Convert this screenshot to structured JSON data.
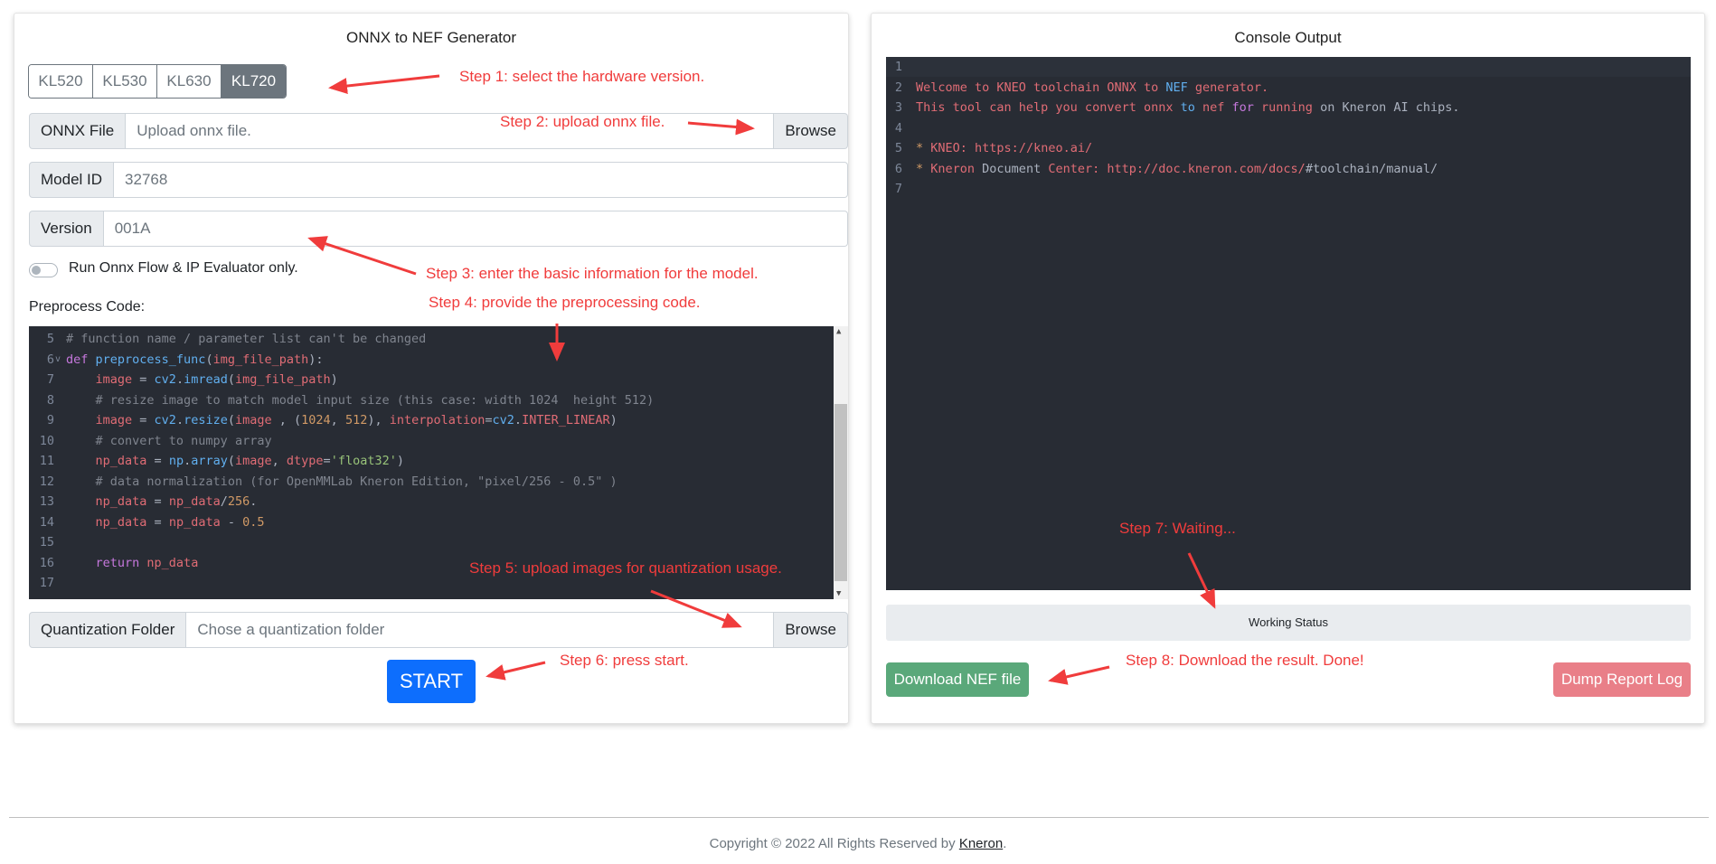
{
  "left_panel": {
    "title": "ONNX to NEF Generator",
    "hardware_options": [
      "KL520",
      "KL530",
      "KL630",
      "KL720"
    ],
    "hardware_selected": "KL720",
    "onnx_label": "ONNX File",
    "onnx_placeholder": "Upload onnx file.",
    "browse_label": "Browse",
    "model_id_label": "Model ID",
    "model_id_placeholder": "32768",
    "version_label": "Version",
    "version_placeholder": "001A",
    "toggle_label": "Run Onnx Flow & IP Evaluator only.",
    "toggle_on": false,
    "preprocess_label": "Preprocess Code:",
    "quant_label": "Quantization Folder",
    "quant_placeholder": "Chose a quantization folder",
    "quant_browse_label": "Browse",
    "start_label": "START"
  },
  "code_lines": [
    {
      "n": "5",
      "fold": "",
      "tokens": [
        [
          "c-cm",
          "# function name / parameter list can't be changed"
        ]
      ]
    },
    {
      "n": "6",
      "fold": "v",
      "tokens": [
        [
          "c-kw",
          "def "
        ],
        [
          "c-fn",
          "preprocess_func"
        ],
        [
          "c-pl",
          "("
        ],
        [
          "c-var",
          "img_file_path"
        ],
        [
          "c-pl",
          "):"
        ]
      ]
    },
    {
      "n": "7",
      "fold": "",
      "tokens": [
        [
          "c-pl",
          "    "
        ],
        [
          "c-var",
          "image"
        ],
        [
          "c-pl",
          " = "
        ],
        [
          "c-fn",
          "cv2"
        ],
        [
          "c-pl",
          "."
        ],
        [
          "c-fn",
          "imread"
        ],
        [
          "c-pl",
          "("
        ],
        [
          "c-var",
          "img_file_path"
        ],
        [
          "c-pl",
          ")"
        ]
      ]
    },
    {
      "n": "8",
      "fold": "",
      "tokens": [
        [
          "c-pl",
          "    "
        ],
        [
          "c-cm",
          "# resize image to match model input size (this case: width 1024  height 512)"
        ]
      ]
    },
    {
      "n": "9",
      "fold": "",
      "tokens": [
        [
          "c-pl",
          "    "
        ],
        [
          "c-var",
          "image"
        ],
        [
          "c-pl",
          " = "
        ],
        [
          "c-fn",
          "cv2"
        ],
        [
          "c-pl",
          "."
        ],
        [
          "c-fn",
          "resize"
        ],
        [
          "c-pl",
          "("
        ],
        [
          "c-var",
          "image"
        ],
        [
          "c-pl",
          " , ("
        ],
        [
          "c-num",
          "1024"
        ],
        [
          "c-pl",
          ", "
        ],
        [
          "c-num",
          "512"
        ],
        [
          "c-pl",
          "), "
        ],
        [
          "c-var",
          "interpolation"
        ],
        [
          "c-pl",
          "="
        ],
        [
          "c-fn",
          "cv2"
        ],
        [
          "c-pl",
          "."
        ],
        [
          "c-var",
          "INTER_LINEAR"
        ],
        [
          "c-pl",
          ")"
        ]
      ]
    },
    {
      "n": "10",
      "fold": "",
      "tokens": [
        [
          "c-pl",
          "    "
        ],
        [
          "c-cm",
          "# convert to numpy array"
        ]
      ]
    },
    {
      "n": "11",
      "fold": "",
      "tokens": [
        [
          "c-pl",
          "    "
        ],
        [
          "c-var",
          "np_data"
        ],
        [
          "c-pl",
          " = "
        ],
        [
          "c-fn",
          "np"
        ],
        [
          "c-pl",
          "."
        ],
        [
          "c-fn",
          "array"
        ],
        [
          "c-pl",
          "("
        ],
        [
          "c-var",
          "image"
        ],
        [
          "c-pl",
          ", "
        ],
        [
          "c-var",
          "dtype"
        ],
        [
          "c-pl",
          "="
        ],
        [
          "c-str",
          "'float32'"
        ],
        [
          "c-pl",
          ")"
        ]
      ]
    },
    {
      "n": "12",
      "fold": "",
      "tokens": [
        [
          "c-pl",
          "    "
        ],
        [
          "c-cm",
          "# data normalization (for OpenMMLab Kneron Edition, \"pixel/256 - 0.5\" )"
        ]
      ]
    },
    {
      "n": "13",
      "fold": "",
      "tokens": [
        [
          "c-pl",
          "    "
        ],
        [
          "c-var",
          "np_data"
        ],
        [
          "c-pl",
          " = "
        ],
        [
          "c-var",
          "np_data"
        ],
        [
          "c-pl",
          "/"
        ],
        [
          "c-num",
          "256"
        ],
        [
          "c-pl",
          "."
        ]
      ]
    },
    {
      "n": "14",
      "fold": "",
      "tokens": [
        [
          "c-pl",
          "    "
        ],
        [
          "c-var",
          "np_data"
        ],
        [
          "c-pl",
          " = "
        ],
        [
          "c-var",
          "np_data"
        ],
        [
          "c-pl",
          " - "
        ],
        [
          "c-num",
          "0.5"
        ]
      ]
    },
    {
      "n": "15",
      "fold": "",
      "tokens": []
    },
    {
      "n": "16",
      "fold": "",
      "tokens": [
        [
          "c-pl",
          "    "
        ],
        [
          "c-kw",
          "return "
        ],
        [
          "c-var",
          "np_data"
        ]
      ]
    },
    {
      "n": "17",
      "fold": "",
      "tokens": []
    }
  ],
  "right_panel": {
    "title": "Console Output",
    "status_label": "Working Status",
    "download_label": "Download NEF file",
    "dump_label": "Dump Report Log"
  },
  "console_lines": [
    {
      "n": "1",
      "tokens": []
    },
    {
      "n": "2",
      "tokens": [
        [
          "c-var",
          "Welcome to KNEO toolchain ONNX to "
        ],
        [
          "c-fn",
          "NEF"
        ],
        [
          "c-var",
          " generator."
        ]
      ]
    },
    {
      "n": "3",
      "tokens": [
        [
          "c-var",
          "This tool can help you convert onnx "
        ],
        [
          "c-fn",
          "to"
        ],
        [
          "c-var",
          " nef "
        ],
        [
          "c-kw",
          "for"
        ],
        [
          "c-var",
          " running "
        ],
        [
          "c-pl",
          "on Kneron AI chips."
        ]
      ]
    },
    {
      "n": "4",
      "tokens": []
    },
    {
      "n": "5",
      "tokens": [
        [
          "c-num",
          "* "
        ],
        [
          "c-var",
          "KNEO: "
        ],
        [
          "c-var",
          "https://kneo.ai/"
        ]
      ]
    },
    {
      "n": "6",
      "tokens": [
        [
          "c-num",
          "* "
        ],
        [
          "c-var",
          "Kneron "
        ],
        [
          "c-pl",
          "Document "
        ],
        [
          "c-var",
          "Center: "
        ],
        [
          "c-var",
          "http://doc.kneron.com/docs/"
        ],
        [
          "c-pl",
          "#toolchain/manual/"
        ]
      ]
    },
    {
      "n": "7",
      "tokens": []
    }
  ],
  "annotations": {
    "step1": "Step 1: select the hardware version.",
    "step2": "Step 2: upload onnx file.",
    "step3": "Step 3: enter the basic information for the model.",
    "step4": "Step 4: provide the preprocessing code.",
    "step5": "Step 5: upload images for quantization usage.",
    "step6": "Step 6: press start.",
    "step7": "Step 7: Waiting...",
    "step8": "Step 8: Download the result. Done!"
  },
  "footer": {
    "text": "Copyright © 2022 All Rights Reserved by ",
    "link": "Kneron",
    "suffix": "."
  },
  "colors": {
    "annotation": "#f03c3c",
    "primary": "#0d6efd",
    "success": "#5aa87a",
    "danger": "#e97f88",
    "editor_bg": "#282c34"
  }
}
